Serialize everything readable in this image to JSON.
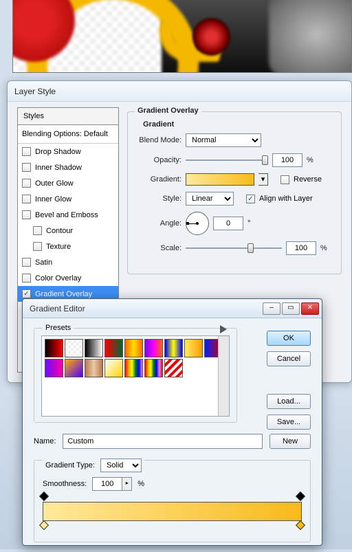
{
  "layer_style": {
    "title": "Layer Style",
    "styles_header": "Styles",
    "blending_options": "Blending Options: Default",
    "items": [
      {
        "label": "Drop Shadow",
        "checked": false
      },
      {
        "label": "Inner Shadow",
        "checked": false
      },
      {
        "label": "Outer Glow",
        "checked": false
      },
      {
        "label": "Inner Glow",
        "checked": false
      },
      {
        "label": "Bevel and Emboss",
        "checked": false
      },
      {
        "label": "Contour",
        "checked": false,
        "indent": true
      },
      {
        "label": "Texture",
        "checked": false,
        "indent": true
      },
      {
        "label": "Satin",
        "checked": false
      },
      {
        "label": "Color Overlay",
        "checked": false
      },
      {
        "label": "Gradient Overlay",
        "checked": true,
        "selected": true
      }
    ]
  },
  "go": {
    "group_title": "Gradient Overlay",
    "inner_title": "Gradient",
    "blend_label": "Blend Mode:",
    "blend_value": "Normal",
    "opacity_label": "Opacity:",
    "opacity_value": "100",
    "pct": "%",
    "gradient_label": "Gradient:",
    "reverse_label": "Reverse",
    "style_label": "Style:",
    "style_value": "Linear",
    "align_label": "Align with Layer",
    "angle_label": "Angle:",
    "angle_value": "0",
    "deg": "°",
    "scale_label": "Scale:",
    "scale_value": "100"
  },
  "ge": {
    "title": "Gradient Editor",
    "presets_label": "Presets",
    "ok": "OK",
    "cancel": "Cancel",
    "load": "Load...",
    "save": "Save...",
    "name_label": "Name:",
    "name_value": "Custom",
    "new": "New",
    "type_label": "Gradient Type:",
    "type_value": "Solid",
    "smooth_label": "Smoothness:",
    "smooth_value": "100",
    "pct": "%"
  },
  "swatches_row1": [
    "linear-gradient(90deg,#000,#f00)",
    "repeating-conic-gradient(#eee 0 25%,#fff 0 50%) 0/8px 8px,linear-gradient(90deg,#fff0,#f00)",
    "linear-gradient(90deg,#000,#fff)",
    "linear-gradient(90deg,#f00,#063)",
    "linear-gradient(90deg,#f60,#ffe000,#f60)",
    "linear-gradient(90deg,#70f,#f0f,#f60)",
    "linear-gradient(90deg,#00f,#ff0,#00f)",
    "linear-gradient(90deg,#ffec60,#ff9c00)",
    "linear-gradient(90deg,#0022ff,#cc0000)"
  ],
  "swatches_row2": [
    "linear-gradient(90deg,#6a0cff,#ff00a6)",
    "linear-gradient(135deg,#ffb100,#5000ff)",
    "linear-gradient(90deg,#b8794e,#e9c9a3,#b8794e)",
    "linear-gradient(135deg,#fff,#ffd400)",
    "linear-gradient(90deg,red,orange,yellow,green,blue,violet)",
    "linear-gradient(90deg,red,orange,yellow,green,blue,violet,red)",
    "repeating-linear-gradient(135deg,#fff 0 4px,#e00 4px 8px)"
  ]
}
